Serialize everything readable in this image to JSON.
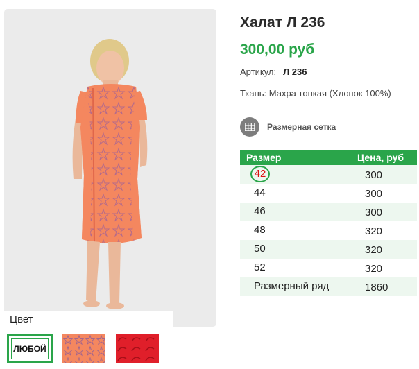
{
  "product": {
    "title": "Халат Л 236",
    "price": "300,00 руб",
    "sku_label": "Артикул:",
    "sku_value": "Л 236",
    "fabric": "Ткань: Махра тонкая (Хлопок 100%)"
  },
  "size_chart_link": {
    "label": "Размерная сетка",
    "icon": "grid-icon"
  },
  "size_table": {
    "headers": [
      "Размер",
      "Цена, руб"
    ],
    "rows": [
      {
        "size": "42",
        "price": "300"
      },
      {
        "size": "44",
        "price": "300"
      },
      {
        "size": "46",
        "price": "300"
      },
      {
        "size": "48",
        "price": "320"
      },
      {
        "size": "50",
        "price": "320"
      },
      {
        "size": "52",
        "price": "320"
      },
      {
        "size": "Размерный ряд",
        "price": "1860"
      }
    ],
    "selected_size": "42"
  },
  "colors": {
    "label": "Цвет",
    "any_label": "ЛЮБОЙ",
    "swatches": [
      "any",
      "orange-print",
      "red-print"
    ],
    "selected": "any"
  },
  "theme": {
    "accent": "#2aa54a",
    "selected_size_text": "#dd1111",
    "dress_color": "#f4875f"
  }
}
